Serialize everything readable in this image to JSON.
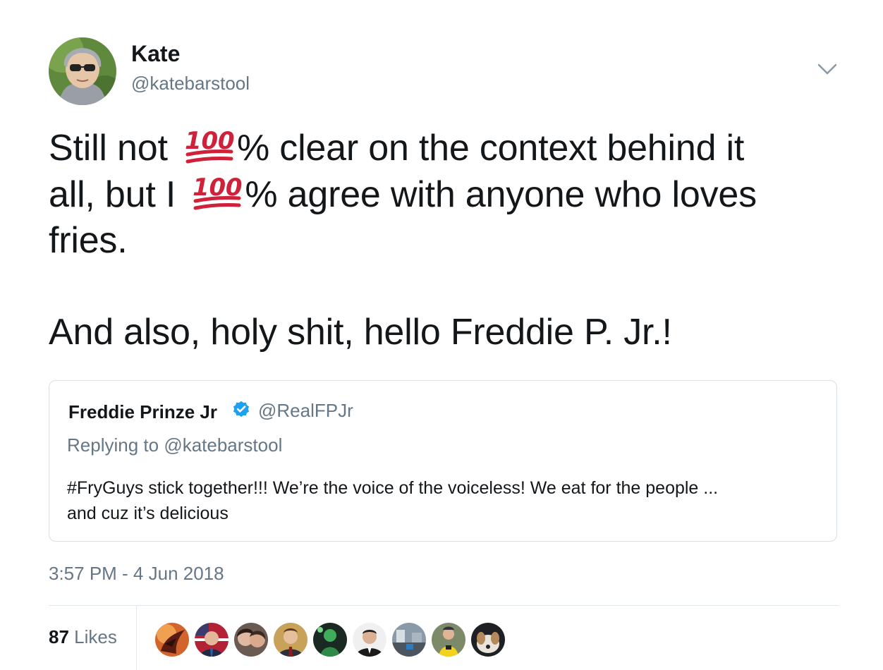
{
  "tweet": {
    "author": {
      "name": "Kate",
      "handle": "@katebarstool"
    },
    "text": {
      "line1_before": "Still not ",
      "line1_after": "% clear on the context behind it",
      "line2_before": "all, but I ",
      "line2_after": "% agree with anyone who loves",
      "line3": "fries.",
      "line4": "And also, holy shit, hello Freddie P. Jr.!",
      "emoji_text": "100"
    },
    "quoted_tweet": {
      "name": "Freddie Prinze Jr",
      "handle": "@RealFPJr",
      "replying_prefix": "Replying to ",
      "replying_to": "@katebarstool",
      "text_line1": "#FryGuys stick together!!! We’re the voice of the voiceless! We eat for the people ...",
      "text_line2": "and cuz it’s delicious"
    },
    "timestamp": "3:57 PM - 4 Jun 2018",
    "stats": {
      "likes_count": "87",
      "likes_label": "Likes"
    },
    "likers": [
      {
        "icon": "avatar-dragon-art"
      },
      {
        "icon": "avatar-man-suit-flag"
      },
      {
        "icon": "avatar-couple-selfie"
      },
      {
        "icon": "avatar-man-tie"
      },
      {
        "icon": "avatar-green-figure"
      },
      {
        "icon": "avatar-man-dark-suit"
      },
      {
        "icon": "avatar-street-scene"
      },
      {
        "icon": "avatar-cyclist-yellow"
      },
      {
        "icon": "avatar-dog"
      }
    ]
  },
  "colors": {
    "text_primary": "#14171a",
    "text_secondary": "#657786",
    "verified_blue": "#1da1f2",
    "emoji_red": "#d0213a",
    "border": "#e1e8ed"
  },
  "icons": {
    "caret": "chevron-down-icon",
    "verified": "verified-badge-icon",
    "emoji": "hundred-points-emoji"
  }
}
